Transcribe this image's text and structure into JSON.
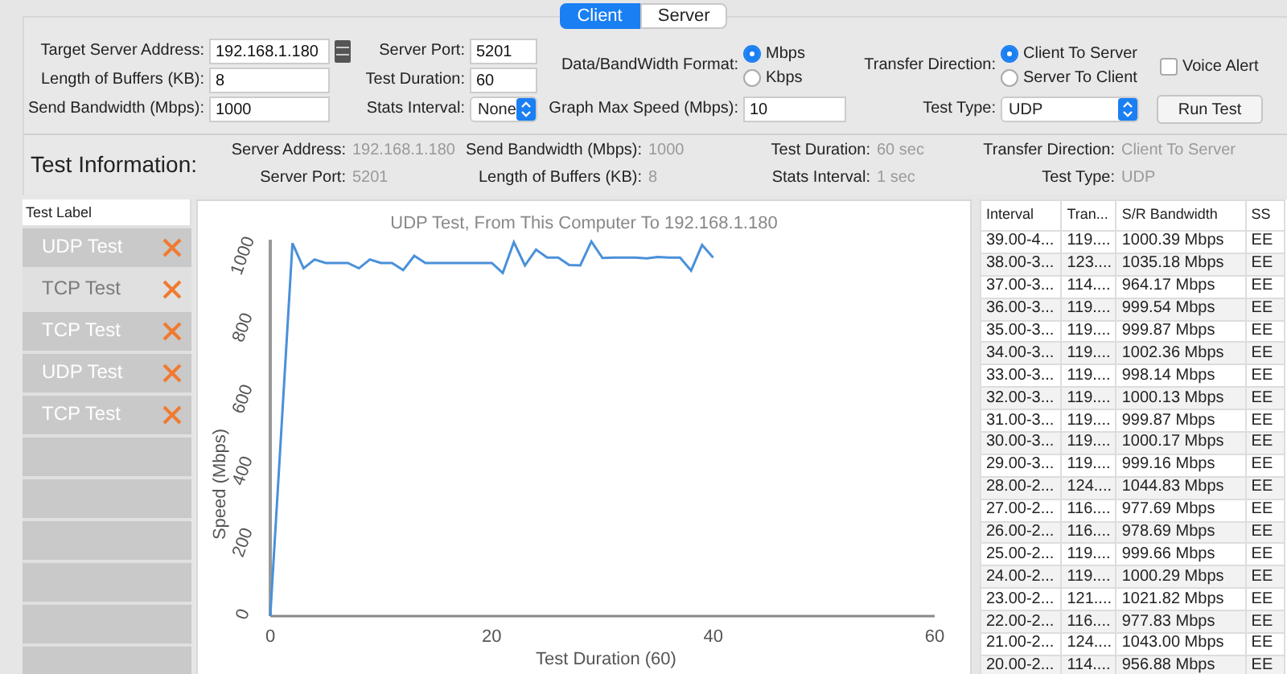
{
  "mode_tabs": [
    {
      "label": "Client",
      "selected": true
    },
    {
      "label": "Server",
      "selected": false
    }
  ],
  "settings": {
    "target_server_address": {
      "label": "Target Server Address:",
      "value": "192.168.1.180"
    },
    "length_of_buffers": {
      "label": "Length of Buffers (KB):",
      "value": "8"
    },
    "send_bandwidth": {
      "label": "Send Bandwidth (Mbps):",
      "value": "1000"
    },
    "server_port": {
      "label": "Server Port:",
      "value": "5201"
    },
    "test_duration": {
      "label": "Test Duration:",
      "value": "60"
    },
    "stats_interval": {
      "label": "Stats Interval:",
      "value": "None"
    },
    "data_format": {
      "label": "Data/BandWidth Format:",
      "options": [
        {
          "label": "Mbps",
          "selected": true
        },
        {
          "label": "Kbps",
          "selected": false
        }
      ]
    },
    "graph_max_speed": {
      "label": "Graph Max Speed (Mbps):",
      "value": "10"
    },
    "transfer_direction": {
      "label": "Transfer Direction:",
      "options": [
        {
          "label": "Client To Server",
          "selected": true
        },
        {
          "label": "Server To Client",
          "selected": false
        }
      ]
    },
    "voice_alert": {
      "label": "Voice Alert",
      "checked": false
    },
    "test_type": {
      "label": "Test Type:",
      "value": "UDP"
    },
    "run_button": "Run Test"
  },
  "test_information": {
    "title": "Test Information:",
    "items": [
      {
        "label": "Server Address:",
        "value": "192.168.1.180"
      },
      {
        "label": "Send Bandwidth (Mbps):",
        "value": "1000"
      },
      {
        "label": "Test Duration:",
        "value": "60 sec"
      },
      {
        "label": "Transfer Direction:",
        "value": "Client To Server"
      },
      {
        "label": "Server Port:",
        "value": "5201"
      },
      {
        "label": "Length of Buffers (KB):",
        "value": "8"
      },
      {
        "label": "Stats Interval:",
        "value": "1 sec"
      },
      {
        "label": "Test Type:",
        "value": "UDP"
      }
    ]
  },
  "test_list": {
    "header": "Test Label",
    "items": [
      {
        "label": "UDP Test",
        "selected": false
      },
      {
        "label": "TCP Test",
        "selected": true
      },
      {
        "label": "TCP Test",
        "selected": false
      },
      {
        "label": "UDP Test",
        "selected": false
      },
      {
        "label": "TCP Test",
        "selected": false
      }
    ]
  },
  "chart": {
    "chart_data": {
      "type": "line",
      "title": "UDP Test,  From This Computer To 192.168.1.180",
      "xlabel": "Test Duration (60)",
      "ylabel": "Speed (Mbps)",
      "xlim": [
        0,
        60
      ],
      "ylim": [
        0,
        1050
      ],
      "xticks": [
        0,
        20,
        40,
        60
      ],
      "yticks": [
        0,
        200,
        400,
        600,
        800,
        1000
      ],
      "x": [
        0,
        2,
        3,
        4,
        5,
        6,
        7,
        8,
        9,
        10,
        11,
        12,
        13,
        14,
        15,
        16,
        17,
        18,
        19,
        20,
        21,
        22,
        23,
        24,
        25,
        26,
        27,
        28,
        29,
        30,
        31,
        32,
        33,
        34,
        35,
        36,
        37,
        38,
        39,
        40
      ],
      "series": [
        {
          "color": "#4a90d9",
          "values": [
            0,
            1040,
            970,
            995,
            985,
            985,
            985,
            970,
            995,
            985,
            985,
            965,
            1005,
            985,
            985,
            985,
            985,
            985,
            985,
            985,
            957,
            1043,
            978,
            1022,
            1000,
            1000,
            979,
            978,
            1045,
            999,
            1000,
            1000,
            1000,
            998,
            1002,
            1000,
            1000,
            964,
            1035,
            1000
          ]
        }
      ]
    }
  },
  "results_table": {
    "columns": [
      "Interval",
      "Tran...",
      "S/R Bandwidth",
      "SS"
    ],
    "rows": [
      [
        "39.00-4...",
        "119....",
        "1000.39 Mbps",
        "EE"
      ],
      [
        "38.00-3...",
        "123....",
        "1035.18 Mbps",
        "EE"
      ],
      [
        "37.00-3...",
        "114....",
        "964.17 Mbps",
        "EE"
      ],
      [
        "36.00-3...",
        "119....",
        "999.54 Mbps",
        "EE"
      ],
      [
        "35.00-3...",
        "119....",
        "999.87 Mbps",
        "EE"
      ],
      [
        "34.00-3...",
        "119....",
        "1002.36 Mbps",
        "EE"
      ],
      [
        "33.00-3...",
        "119....",
        "998.14 Mbps",
        "EE"
      ],
      [
        "32.00-3...",
        "119....",
        "1000.13 Mbps",
        "EE"
      ],
      [
        "31.00-3...",
        "119....",
        "999.87 Mbps",
        "EE"
      ],
      [
        "30.00-3...",
        "119....",
        "1000.17 Mbps",
        "EE"
      ],
      [
        "29.00-3...",
        "119....",
        "999.16 Mbps",
        "EE"
      ],
      [
        "28.00-2...",
        "124....",
        "1044.83 Mbps",
        "EE"
      ],
      [
        "27.00-2...",
        "116....",
        "977.69 Mbps",
        "EE"
      ],
      [
        "26.00-2...",
        "116....",
        "978.69 Mbps",
        "EE"
      ],
      [
        "25.00-2...",
        "119....",
        "999.66 Mbps",
        "EE"
      ],
      [
        "24.00-2...",
        "119....",
        "1000.29 Mbps",
        "EE"
      ],
      [
        "23.00-2...",
        "121....",
        "1021.82 Mbps",
        "EE"
      ],
      [
        "22.00-2...",
        "116....",
        "977.83 Mbps",
        "EE"
      ],
      [
        "21.00-2...",
        "124....",
        "1043.00 Mbps",
        "EE"
      ],
      [
        "20.00-2...",
        "114....",
        "956.88 Mbps",
        "EE"
      ]
    ]
  }
}
